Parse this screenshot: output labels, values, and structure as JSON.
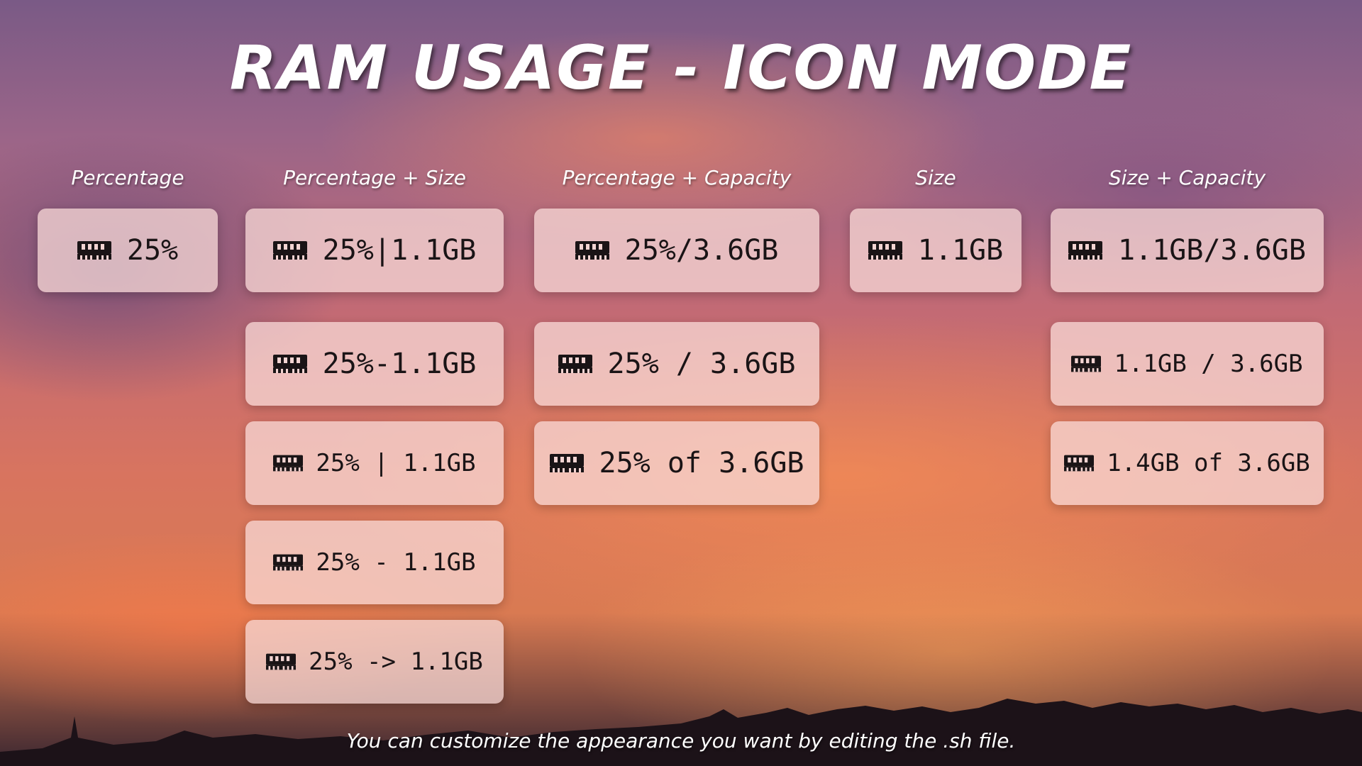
{
  "title": "RAM USAGE - ICON MODE",
  "columns": {
    "percentage": "Percentage",
    "percentage_size": "Percentage + Size",
    "percentage_capacity": "Percentage + Capacity",
    "size": "Size",
    "size_capacity": "Size + Capacity"
  },
  "cards": {
    "percentage": [
      "25%"
    ],
    "percentage_size": [
      "25%|1.1GB",
      "25%-1.1GB",
      "25% | 1.1GB",
      "25% - 1.1GB",
      "25% -> 1.1GB"
    ],
    "percentage_capacity": [
      "25%/3.6GB",
      "25% / 3.6GB",
      "25% of 3.6GB"
    ],
    "size": [
      "1.1GB"
    ],
    "size_capacity": [
      "1.1GB/3.6GB",
      "1.1GB / 3.6GB",
      "1.4GB of 3.6GB"
    ]
  },
  "icon": "ram-memory-icon",
  "footer": "You can customize the appearance you want by editing the .sh file.",
  "colors": {
    "card_background": "#f8dad8",
    "text": "#1a1416",
    "title": "#ffffff"
  }
}
